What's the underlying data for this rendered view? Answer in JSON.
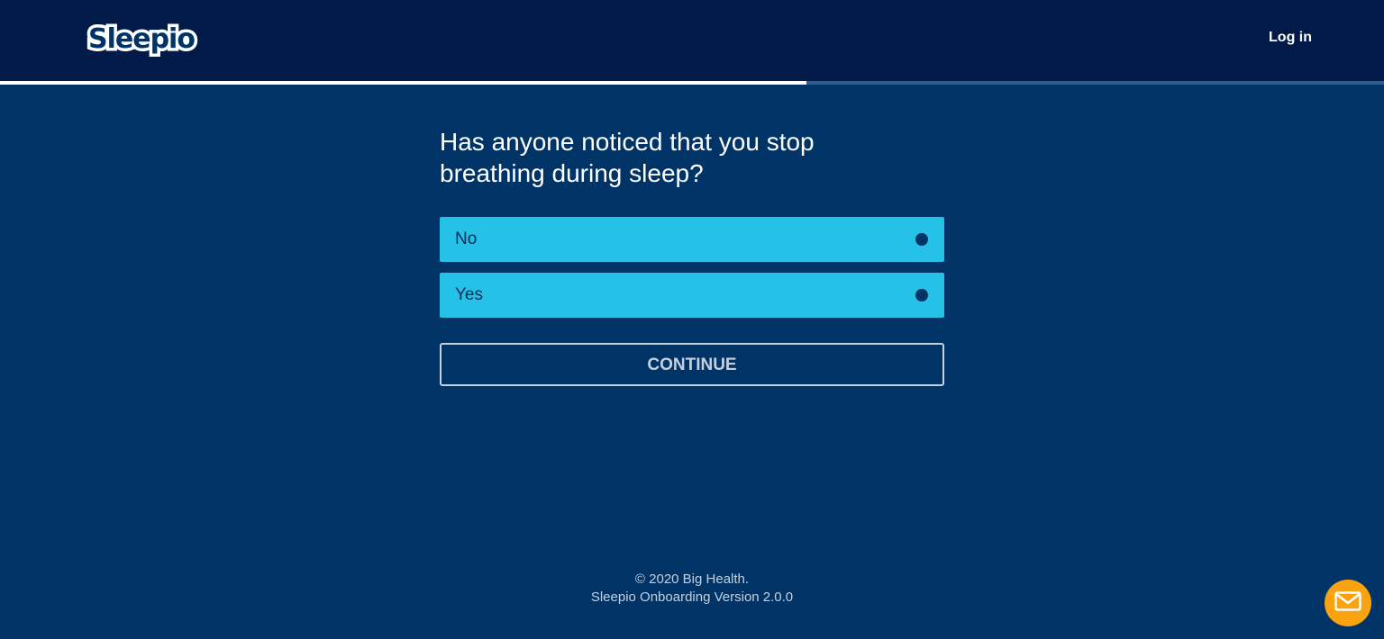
{
  "header": {
    "logo_text": "Sleepio",
    "logo_tm": "™",
    "login_label": "Log in"
  },
  "progress": {
    "fraction": 0.583
  },
  "question": {
    "text": "Has anyone noticed that you stop breathing during sleep?"
  },
  "options": [
    {
      "label": "No"
    },
    {
      "label": "Yes"
    }
  ],
  "continue_label": "CONTINUE",
  "footer": {
    "copyright": "© 2020 Big Health.",
    "version": "Sleepio Onboarding Version 2.0.0"
  },
  "chat": {
    "icon": "mail-icon"
  },
  "colors": {
    "topbar": "#011a48",
    "background": "#003366",
    "option": "#26c1e6",
    "chat": "#f9a311"
  }
}
